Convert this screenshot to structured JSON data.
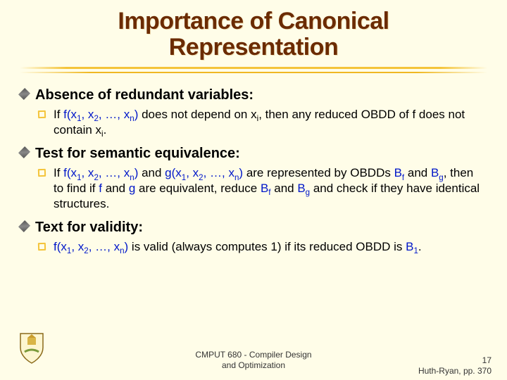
{
  "title_line1": "Importance of Canonical",
  "title_line2": "Representation",
  "sections": [
    {
      "heading": "Absence of redundant variables:",
      "body_prefix": "If ",
      "fn_open": "f(x",
      "fn_args_plain": ", x",
      "fn_mid": ", …, x",
      "fn_close": ")",
      "body_mid1": " does not depend on x",
      "body_mid2": ", then any reduced OBDD of f does not contain x",
      "body_tail": "."
    },
    {
      "heading": "Test for semantic equivalence:",
      "body": "If f(x1, x2, …, xn) and g(x1, x2, …, xn) are represented by OBDDs Bf and Bg, then to find if f and g are equivalent, reduce Bf and Bg and check if they have identical structures."
    },
    {
      "heading": "Text for validity:",
      "body": "f(x1, x2, …, xn) is valid (always computes 1) if its reduced OBDD is B1."
    }
  ],
  "subs": {
    "one": "1",
    "two": "2",
    "n": "n",
    "i": "i",
    "f": "f",
    "g": "g"
  },
  "plain": {
    "If": "If ",
    "and": " and ",
    "are_rep": " are represented by OBDDs ",
    "then_to": ", then to find if ",
    "are_equiv": " are equivalent, reduce ",
    "check": " and check if they have identical structures.",
    "valid": " is valid (always computes 1) if its reduced OBDD is ",
    "period": "."
  },
  "footer": {
    "course_line1": "CMPUT 680 - Compiler Design",
    "course_line2": "and Optimization",
    "page_no": "17",
    "ref": "Huth-Ryan, pp. 370"
  }
}
